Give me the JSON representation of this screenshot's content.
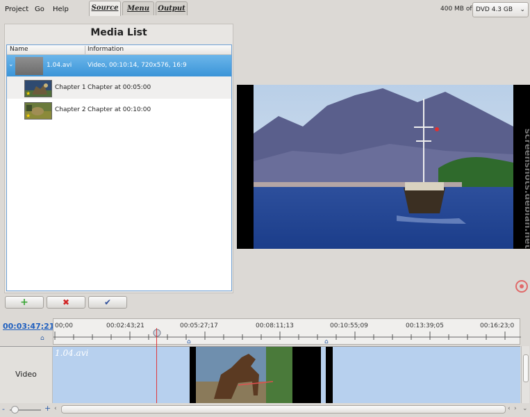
{
  "menu": {
    "project": "Project",
    "go": "Go",
    "help": "Help"
  },
  "tabs": [
    {
      "label": "Source",
      "active": true
    },
    {
      "label": "Menu",
      "active": false
    },
    {
      "label": "Output",
      "active": false
    }
  ],
  "disc": {
    "size_label": "400 MB of",
    "selected": "DVD 4.3 GB"
  },
  "media_list": {
    "title": "Media List",
    "columns": [
      "Name",
      "Information"
    ],
    "rows": [
      {
        "name": "1.04.avi",
        "info": "Video, 00:10:14, 720x576, 16:9",
        "selected": true
      },
      {
        "name": "Chapter 1",
        "info": "Chapter at 00:05:00"
      },
      {
        "name": "Chapter 2",
        "info": "Chapter at 00:10:00"
      }
    ]
  },
  "buttons": {
    "add": "+",
    "remove": "✖",
    "apply": "✔"
  },
  "watermark": "screenshots.debian.net",
  "timeline": {
    "timecode": "00:03:47;21",
    "ticks": [
      "00;00",
      "00:02:43;21",
      "00:05:27;17",
      "00:08:11;13",
      "00:10:55;09",
      "00:13:39;05",
      "00:16:23;0"
    ],
    "track_label": "Video",
    "clip_label": "1.04.avi",
    "zoom_minus": "-",
    "zoom_plus": "+"
  },
  "colors": {
    "selection": "#3a94d8",
    "playhead": "#e0383a",
    "timecode": "#1f5fbf"
  }
}
